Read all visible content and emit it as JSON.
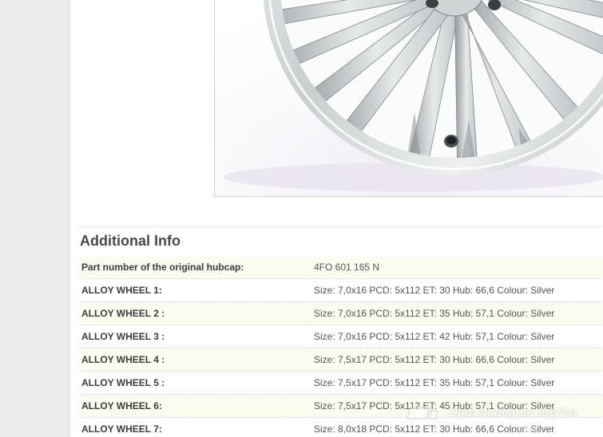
{
  "product_image": {
    "alt": "Alloy wheel"
  },
  "additional_info": {
    "title": "Additional Info",
    "rows": [
      {
        "label": "Part number of the original hubcap:",
        "value": "4FO 601 165 N"
      },
      {
        "label": "ALLOY WHEEL 1:",
        "value": "Size: 7,0x16 PCD: 5x112 ET: 30 Hub: 66,6 Colour: Silver"
      },
      {
        "label": "ALLOY WHEEL 2 :",
        "value": "Size: 7,0x16 PCD: 5x112 ET: 35 Hub: 57,1 Colour: Silver"
      },
      {
        "label": "ALLOY WHEEL 3 :",
        "value": "Size: 7,0x16 PCD: 5x112 ET: 42 Hub: 57,1 Colour: Silver"
      },
      {
        "label": "ALLOY WHEEL 4 :",
        "value": "Size: 7,5x17 PCD: 5x112 ET: 30 Hub: 66,6 Colour: Silver"
      },
      {
        "label": "ALLOY WHEEL 5 :",
        "value": "Size: 7,5x17 PCD: 5x112 ET: 35 Hub: 57,1 Colour: Silver"
      },
      {
        "label": "ALLOY WHEEL 6:",
        "value": "Size: 7,5x17 PCD: 5x112 ET: 45 Hub: 57,1 Colour: Silver"
      },
      {
        "label": "ALLOY WHEEL 7:",
        "value": "Size: 8,0x18 PCD: 5x112 ET: 30 Hub: 66,6 Colour: Silver"
      }
    ]
  },
  "watermark": {
    "text": "Club Audisport Ibérica",
    "sub": ".com"
  },
  "colors": {
    "page_bg": "#ececec",
    "content_bg": "#ffffff",
    "row_alt_bg": "#fbfbef",
    "heading": "#4a4a4a"
  }
}
